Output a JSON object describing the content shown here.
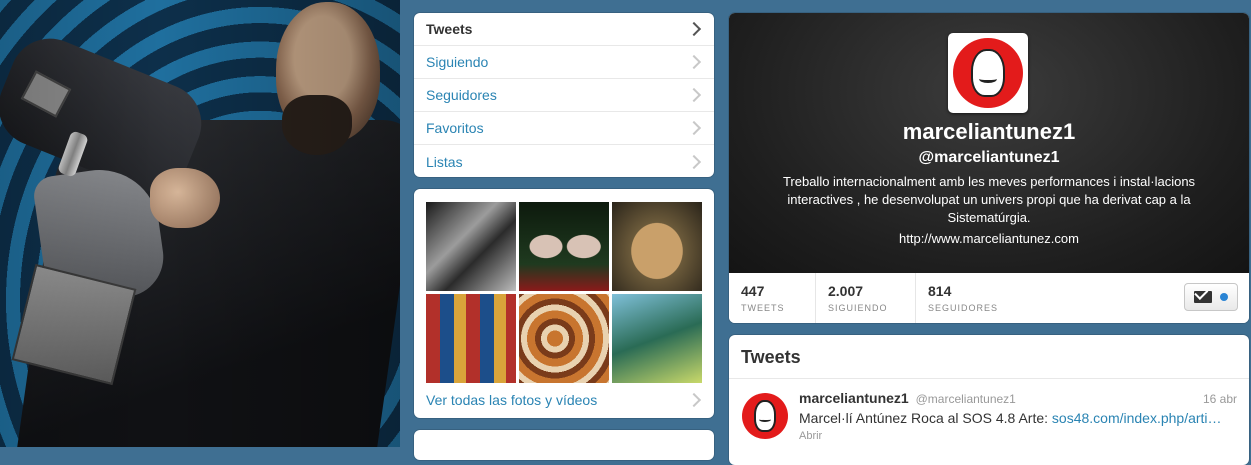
{
  "nav": {
    "items": [
      {
        "label": "Tweets",
        "active": true
      },
      {
        "label": "Siguiendo",
        "active": false
      },
      {
        "label": "Seguidores",
        "active": false
      },
      {
        "label": "Favoritos",
        "active": false
      },
      {
        "label": "Listas",
        "active": false
      }
    ]
  },
  "media": {
    "link_label": "Ver todas las fotos y vídeos"
  },
  "profile": {
    "name": "marceliantunez1",
    "handle": "@marceliantunez1",
    "bio": "Treballo internacionalment amb les meves performances i instal·lacions interactives , he desenvolupat un univers propi que ha derivat cap a la Sistematúrgia.",
    "url": "http://www.marceliantunez.com",
    "stats": [
      {
        "value": "447",
        "label": "TWEETS"
      },
      {
        "value": "2.007",
        "label": "SIGUIENDO"
      },
      {
        "value": "814",
        "label": "SEGUIDORES"
      }
    ],
    "dm_icon": "envelope-icon"
  },
  "tweets": {
    "title": "Tweets",
    "items": [
      {
        "name": "marceliantunez1",
        "handle": "@marceliantunez1",
        "date": "16 abr",
        "text": "Marcel·lí Antúnez Roca al SOS 4.8 Arte: ",
        "link": "sos48.com/index.php/arti…",
        "action": "Abrir"
      }
    ]
  },
  "colors": {
    "link": "#2a84b3",
    "avatar_red": "#e31b1b",
    "page_bg": "#3f6f92"
  }
}
